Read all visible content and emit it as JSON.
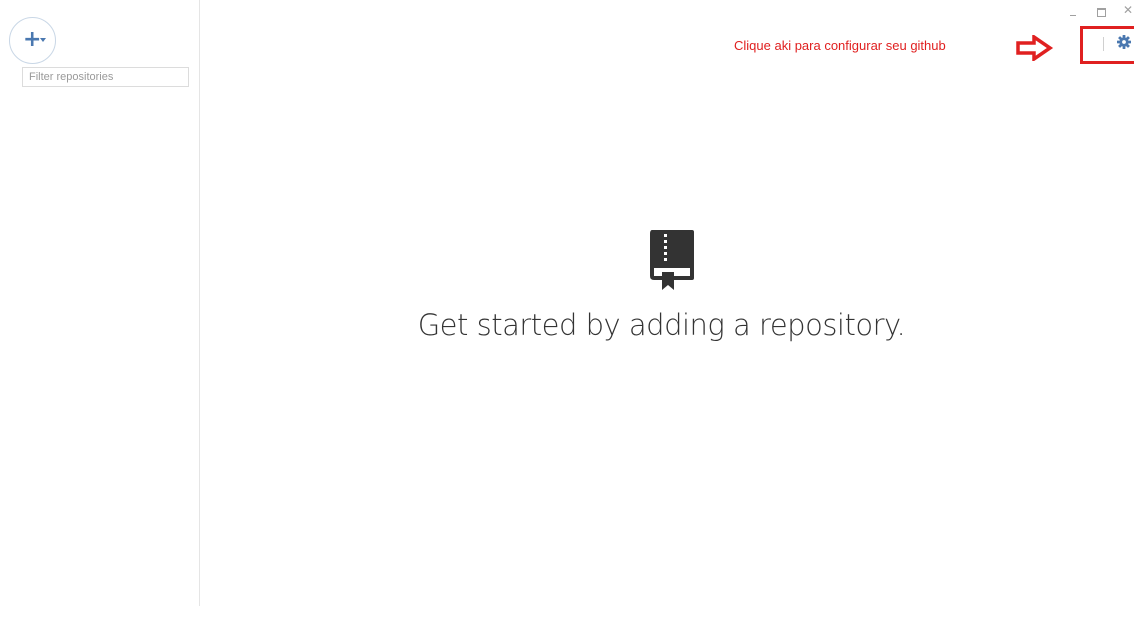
{
  "sidebar": {
    "add_button_icon": "plus-icon",
    "filter_placeholder": "Filter repositories",
    "filter_value": ""
  },
  "window_controls": {
    "minimize_icon": "minimize-icon",
    "maximize_icon": "maximize-icon",
    "close_icon": "close-icon",
    "close_glyph": "✕"
  },
  "annotation": {
    "text": "Clique aki para configurar seu github",
    "color": "#e02020",
    "arrow_icon": "arrow-right-icon"
  },
  "toolbar": {
    "settings_icon": "gear-icon",
    "settings_color": "#4a78b0"
  },
  "empty_state": {
    "icon": "repository-book-icon",
    "message": "Get started by adding a repository."
  }
}
